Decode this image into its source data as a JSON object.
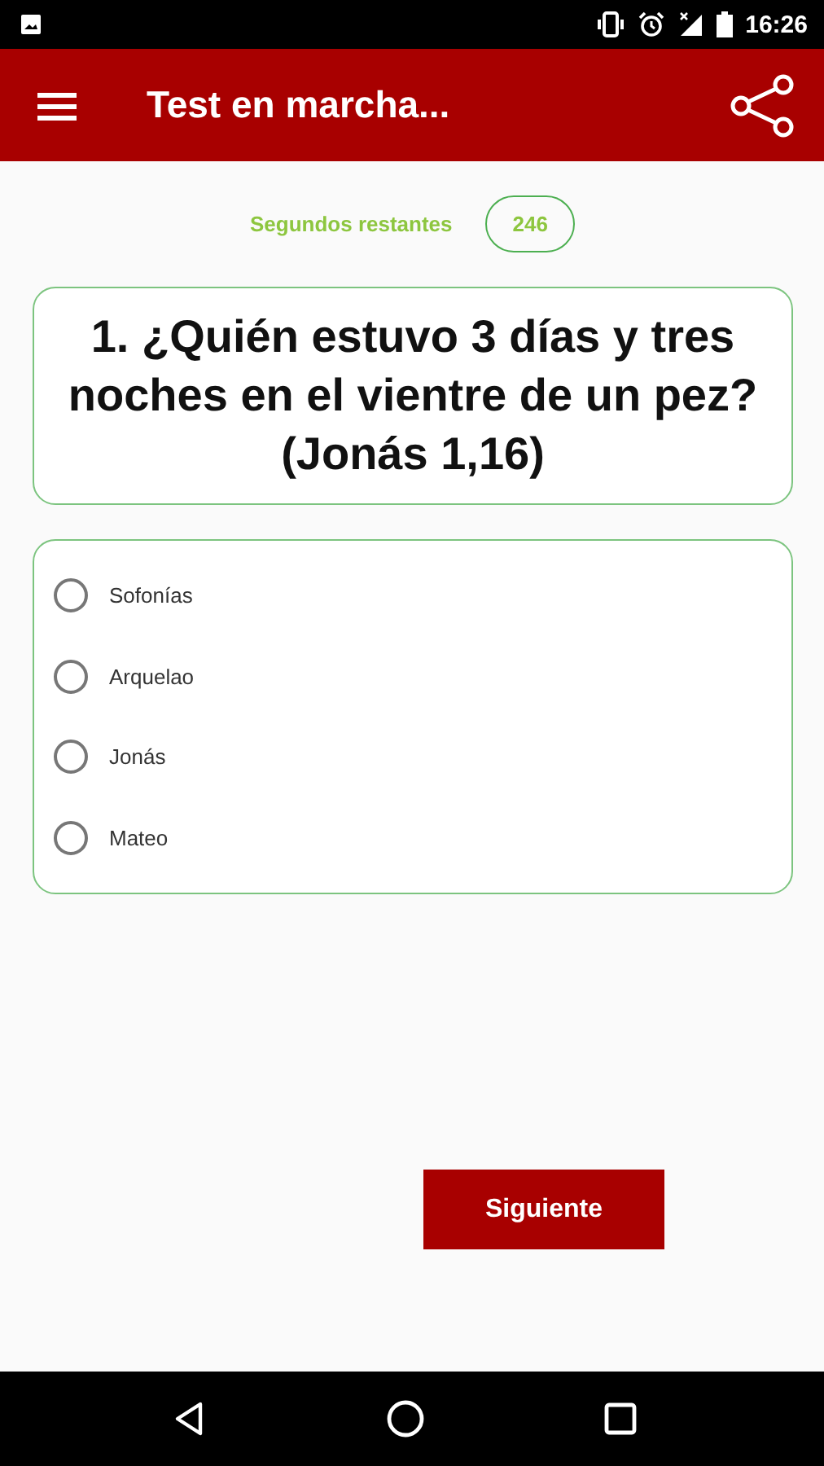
{
  "status_bar": {
    "time": "16:26"
  },
  "app_bar": {
    "title": "Test en marcha..."
  },
  "timer": {
    "label": "Segundos restantes",
    "value": "246"
  },
  "question": {
    "text": "1. ¿Quién estuvo 3 días y tres noches en el vientre de un pez? (Jonás 1,16)"
  },
  "options": [
    {
      "label": "Sofonías",
      "selected": false
    },
    {
      "label": "Arquelao",
      "selected": false
    },
    {
      "label": "Jonás",
      "selected": false
    },
    {
      "label": "Mateo",
      "selected": false
    }
  ],
  "next_button": {
    "label": "Siguiente"
  }
}
